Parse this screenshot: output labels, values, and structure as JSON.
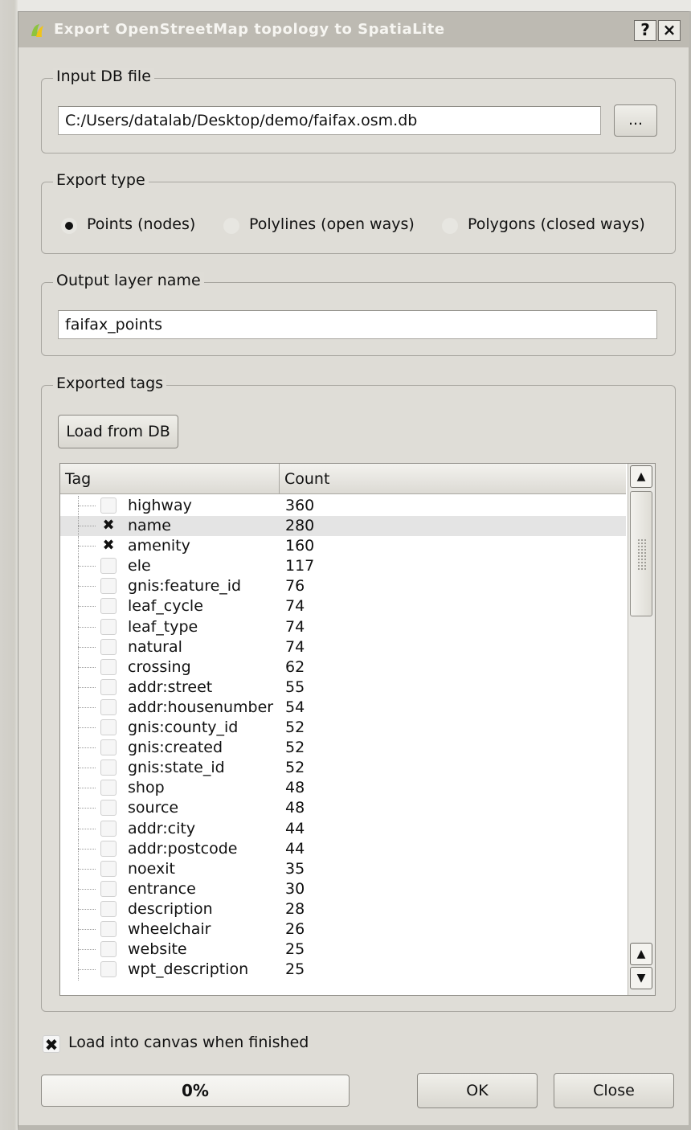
{
  "window": {
    "title": "Export OpenStreetMap topology to SpatiaLite",
    "help_btn": "?",
    "close_btn": "×"
  },
  "input_db": {
    "group_title": "Input DB file",
    "path": "C:/Users/datalab/Desktop/demo/faifax.osm.db",
    "browse_label": "..."
  },
  "export_type": {
    "group_title": "Export type",
    "options": [
      {
        "label": "Points (nodes)",
        "selected": true
      },
      {
        "label": "Polylines (open ways)",
        "selected": false
      },
      {
        "label": "Polygons (closed ways)",
        "selected": false
      }
    ]
  },
  "output_layer": {
    "group_title": "Output layer name",
    "value": "faifax_points"
  },
  "exported_tags": {
    "group_title": "Exported tags",
    "load_btn": "Load from DB",
    "col_tag": "Tag",
    "col_count": "Count",
    "rows": [
      {
        "tag": "highway",
        "count": "360",
        "checked": false
      },
      {
        "tag": "name",
        "count": "280",
        "checked": true
      },
      {
        "tag": "amenity",
        "count": "160",
        "checked": true
      },
      {
        "tag": "ele",
        "count": "117",
        "checked": false
      },
      {
        "tag": "gnis:feature_id",
        "count": "76",
        "checked": false
      },
      {
        "tag": "leaf_cycle",
        "count": "74",
        "checked": false
      },
      {
        "tag": "leaf_type",
        "count": "74",
        "checked": false
      },
      {
        "tag": "natural",
        "count": "74",
        "checked": false
      },
      {
        "tag": "crossing",
        "count": "62",
        "checked": false
      },
      {
        "tag": "addr:street",
        "count": "55",
        "checked": false
      },
      {
        "tag": "addr:housenumber",
        "count": "54",
        "checked": false
      },
      {
        "tag": "gnis:county_id",
        "count": "52",
        "checked": false
      },
      {
        "tag": "gnis:created",
        "count": "52",
        "checked": false
      },
      {
        "tag": "gnis:state_id",
        "count": "52",
        "checked": false
      },
      {
        "tag": "shop",
        "count": "48",
        "checked": false
      },
      {
        "tag": "source",
        "count": "48",
        "checked": false
      },
      {
        "tag": "addr:city",
        "count": "44",
        "checked": false
      },
      {
        "tag": "addr:postcode",
        "count": "44",
        "checked": false
      },
      {
        "tag": "noexit",
        "count": "35",
        "checked": false
      },
      {
        "tag": "entrance",
        "count": "30",
        "checked": false
      },
      {
        "tag": "description",
        "count": "28",
        "checked": false
      },
      {
        "tag": "wheelchair",
        "count": "26",
        "checked": false
      },
      {
        "tag": "website",
        "count": "25",
        "checked": false
      },
      {
        "tag": "wpt_description",
        "count": "25",
        "checked": false
      }
    ]
  },
  "load_canvas": {
    "label": "Load into canvas when finished",
    "checked": true
  },
  "progress": {
    "value": 0,
    "text": "0%"
  },
  "buttons": {
    "ok": "OK",
    "close": "Close"
  },
  "icons": {
    "title_icon": "qgis-logo-icon",
    "scroll_up": "arrow-up-icon",
    "scroll_down": "arrow-down-icon"
  }
}
